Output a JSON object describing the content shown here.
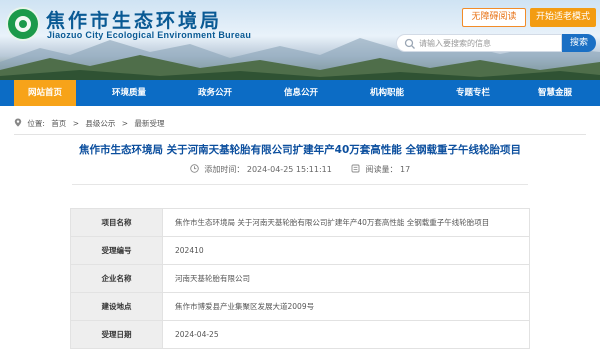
{
  "header": {
    "site_title": "焦作市生态环境局",
    "site_subtitle": "Jiaozuo City Ecological Environment Bureau",
    "accessibility_label": "无障碍阅读",
    "elder_mode_label": "开始适老模式",
    "search": {
      "placeholder": "请输入要搜索的信息",
      "button_label": "搜索"
    }
  },
  "nav": {
    "items": [
      {
        "label": "网站首页",
        "active": true
      },
      {
        "label": "环境质量"
      },
      {
        "label": "政务公开"
      },
      {
        "label": "信息公开"
      },
      {
        "label": "机构职能"
      },
      {
        "label": "专题专栏"
      },
      {
        "label": "智慧金服"
      }
    ]
  },
  "breadcrumb": {
    "prefix": "位置:",
    "items": [
      "首页",
      "县级公示",
      "最新受理"
    ],
    "separator": ">"
  },
  "article": {
    "title": "焦作市生态环境局 关于河南天基轮胎有限公司扩建年产40万套高性能 全钢载重子午线轮胎项目",
    "date_label": "添加时间：",
    "date_value": "2024-04-25 15:11:11",
    "views_label": "阅读量：",
    "views_value": "17"
  },
  "table": {
    "rows": [
      {
        "key": "项目名称",
        "value": "焦作市生态环境局 关于河南天基轮胎有限公司扩建年产40万套高性能 全钢载重子午线轮胎项目"
      },
      {
        "key": "受理编号",
        "value": "202410"
      },
      {
        "key": "企业名称",
        "value": "河南天基轮胎有限公司"
      },
      {
        "key": "建设地点",
        "value": "焦作市博爱县产业集聚区发展大道2009号"
      },
      {
        "key": "受理日期",
        "value": "2024-04-25"
      }
    ]
  },
  "colors": {
    "nav": "#0c6cc5",
    "nav_active": "#f7a319",
    "title": "#0c4f9e",
    "brand": "#0a5a94"
  }
}
